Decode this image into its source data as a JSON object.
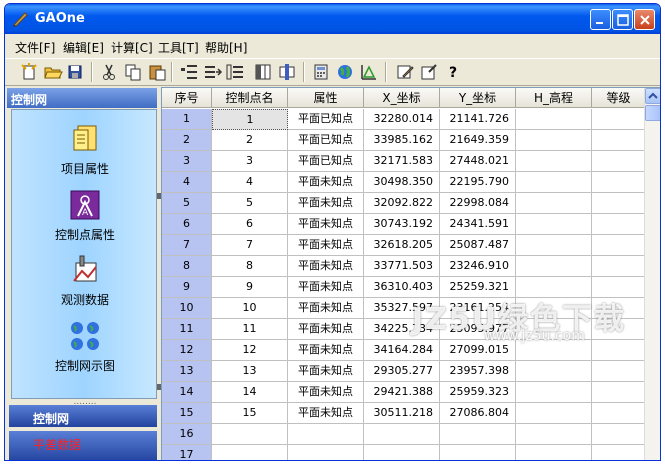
{
  "window": {
    "title": "GAOne"
  },
  "menu": [
    "文件[F]",
    "编辑[E]",
    "计算[C]",
    "工具[T]",
    "帮助[H]"
  ],
  "left_panel": {
    "header": "控制网",
    "items": [
      {
        "label": "项目属性",
        "icon": "project-properties-icon"
      },
      {
        "label": "控制点属性",
        "icon": "control-point-properties-icon"
      },
      {
        "label": "观测数据",
        "icon": "observation-data-icon"
      },
      {
        "label": "控制网示图",
        "icon": "network-diagram-icon"
      }
    ],
    "tab_active": "控制网",
    "tab_other": "平差数据"
  },
  "table": {
    "columns": [
      "序号",
      "控制点名",
      "属性",
      "X_坐标",
      "Y_坐标",
      "H_高程",
      "等级"
    ],
    "rows": [
      [
        "1",
        "1",
        "平面已知点",
        "32280.014",
        "21141.726",
        "",
        ""
      ],
      [
        "2",
        "2",
        "平面已知点",
        "33985.162",
        "21649.359",
        "",
        ""
      ],
      [
        "3",
        "3",
        "平面已知点",
        "32171.583",
        "27448.021",
        "",
        ""
      ],
      [
        "4",
        "4",
        "平面未知点",
        "30498.350",
        "22195.790",
        "",
        ""
      ],
      [
        "5",
        "5",
        "平面未知点",
        "32092.822",
        "22998.084",
        "",
        ""
      ],
      [
        "6",
        "6",
        "平面未知点",
        "30743.192",
        "24341.591",
        "",
        ""
      ],
      [
        "7",
        "7",
        "平面未知点",
        "32618.205",
        "25087.487",
        "",
        ""
      ],
      [
        "8",
        "8",
        "平面未知点",
        "33771.503",
        "23246.910",
        "",
        ""
      ],
      [
        "9",
        "9",
        "平面未知点",
        "36310.403",
        "25259.321",
        "",
        ""
      ],
      [
        "10",
        "10",
        "平面未知点",
        "35327.597",
        "23161.254",
        "",
        ""
      ],
      [
        "11",
        "11",
        "平面未知点",
        "34225.734",
        "25095.977",
        "",
        ""
      ],
      [
        "12",
        "12",
        "平面未知点",
        "34164.284",
        "27099.015",
        "",
        ""
      ],
      [
        "13",
        "13",
        "平面未知点",
        "29305.277",
        "23957.398",
        "",
        ""
      ],
      [
        "14",
        "14",
        "平面未知点",
        "29421.388",
        "25959.323",
        "",
        ""
      ],
      [
        "15",
        "15",
        "平面未知点",
        "30511.218",
        "27086.804",
        "",
        ""
      ],
      [
        "16",
        "",
        "",
        "",
        "",
        "",
        ""
      ],
      [
        "17",
        "",
        "",
        "",
        "",
        "",
        ""
      ]
    ]
  },
  "watermark": {
    "main": "JZ5U绿色下载",
    "sub": "www.jz5u.com"
  }
}
